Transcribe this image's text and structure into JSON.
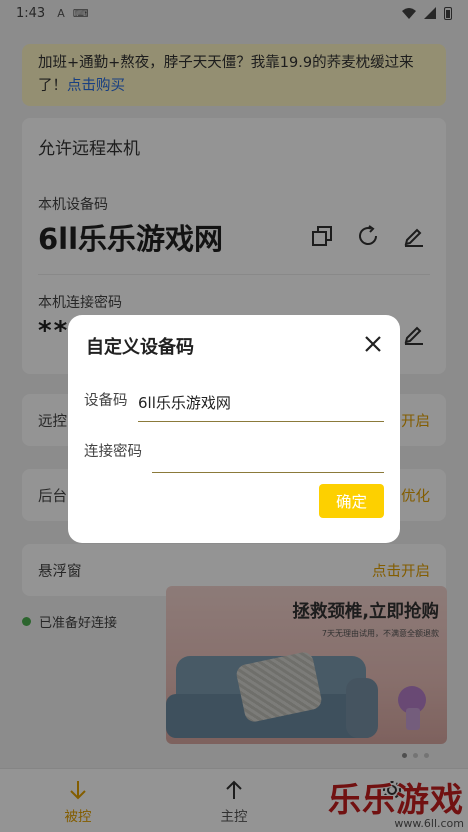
{
  "status_bar": {
    "time": "1:43",
    "app_badge": "A"
  },
  "banner": {
    "text": "加班+通勤+熬夜，脖子天天僵？我靠19.9的荞麦枕缓过来了！",
    "link": "点击购买"
  },
  "main_card": {
    "title": "允许远程本机",
    "device_code_label": "本机设备码",
    "device_code": "6ll乐乐游戏网",
    "password_label": "本机连接密码",
    "password_mask": "**"
  },
  "rows": {
    "remote_label": "远控",
    "remote_action": "开启",
    "background_label": "后台",
    "background_action": "优化",
    "float_label": "悬浮窗",
    "float_action": "点击开启"
  },
  "connection_status": "已准备好连接",
  "ad": {
    "headline": "拯救颈椎,立即抢购",
    "subline": "7天无理由试用，不满意全额退款"
  },
  "bottom_nav": {
    "controlled": "被控",
    "master": "主控"
  },
  "watermark": {
    "title": "乐乐游戏",
    "url": "www.6ll.com"
  },
  "dialog": {
    "title": "自定义设备码",
    "device_code_label": "设备码",
    "device_code_value": "6ll乐乐游戏网",
    "password_label": "连接密码",
    "password_value": "",
    "confirm": "确定"
  },
  "colors": {
    "accent": "#fdd000",
    "action_text": "#e2a000",
    "link": "#2a6de0",
    "banner_bg": "#fff6c4",
    "status_ok": "#4caf50",
    "overlay": "rgba(0,0,0,0.42)"
  }
}
